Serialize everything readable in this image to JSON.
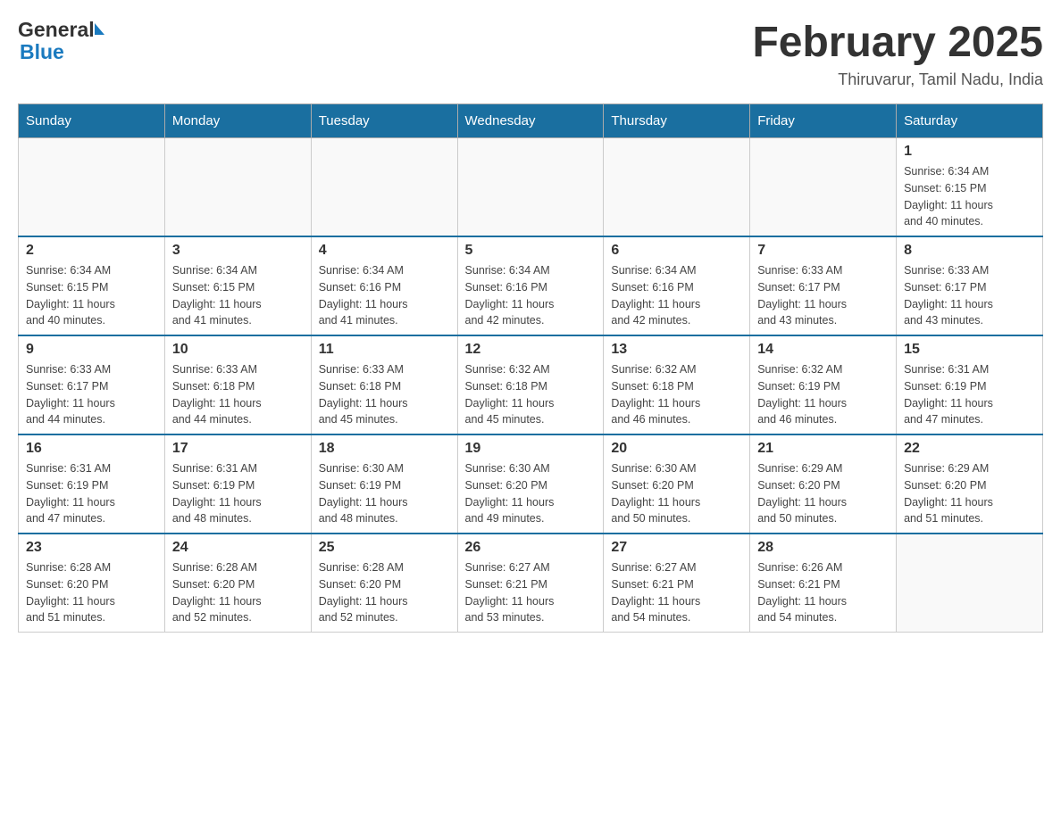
{
  "header": {
    "logo_general": "General",
    "logo_blue": "Blue",
    "title": "February 2025",
    "subtitle": "Thiruvarur, Tamil Nadu, India"
  },
  "days_of_week": [
    "Sunday",
    "Monday",
    "Tuesday",
    "Wednesday",
    "Thursday",
    "Friday",
    "Saturday"
  ],
  "weeks": [
    {
      "days": [
        {
          "num": "",
          "info": ""
        },
        {
          "num": "",
          "info": ""
        },
        {
          "num": "",
          "info": ""
        },
        {
          "num": "",
          "info": ""
        },
        {
          "num": "",
          "info": ""
        },
        {
          "num": "",
          "info": ""
        },
        {
          "num": "1",
          "info": "Sunrise: 6:34 AM\nSunset: 6:15 PM\nDaylight: 11 hours\nand 40 minutes."
        }
      ]
    },
    {
      "days": [
        {
          "num": "2",
          "info": "Sunrise: 6:34 AM\nSunset: 6:15 PM\nDaylight: 11 hours\nand 40 minutes."
        },
        {
          "num": "3",
          "info": "Sunrise: 6:34 AM\nSunset: 6:15 PM\nDaylight: 11 hours\nand 41 minutes."
        },
        {
          "num": "4",
          "info": "Sunrise: 6:34 AM\nSunset: 6:16 PM\nDaylight: 11 hours\nand 41 minutes."
        },
        {
          "num": "5",
          "info": "Sunrise: 6:34 AM\nSunset: 6:16 PM\nDaylight: 11 hours\nand 42 minutes."
        },
        {
          "num": "6",
          "info": "Sunrise: 6:34 AM\nSunset: 6:16 PM\nDaylight: 11 hours\nand 42 minutes."
        },
        {
          "num": "7",
          "info": "Sunrise: 6:33 AM\nSunset: 6:17 PM\nDaylight: 11 hours\nand 43 minutes."
        },
        {
          "num": "8",
          "info": "Sunrise: 6:33 AM\nSunset: 6:17 PM\nDaylight: 11 hours\nand 43 minutes."
        }
      ]
    },
    {
      "days": [
        {
          "num": "9",
          "info": "Sunrise: 6:33 AM\nSunset: 6:17 PM\nDaylight: 11 hours\nand 44 minutes."
        },
        {
          "num": "10",
          "info": "Sunrise: 6:33 AM\nSunset: 6:18 PM\nDaylight: 11 hours\nand 44 minutes."
        },
        {
          "num": "11",
          "info": "Sunrise: 6:33 AM\nSunset: 6:18 PM\nDaylight: 11 hours\nand 45 minutes."
        },
        {
          "num": "12",
          "info": "Sunrise: 6:32 AM\nSunset: 6:18 PM\nDaylight: 11 hours\nand 45 minutes."
        },
        {
          "num": "13",
          "info": "Sunrise: 6:32 AM\nSunset: 6:18 PM\nDaylight: 11 hours\nand 46 minutes."
        },
        {
          "num": "14",
          "info": "Sunrise: 6:32 AM\nSunset: 6:19 PM\nDaylight: 11 hours\nand 46 minutes."
        },
        {
          "num": "15",
          "info": "Sunrise: 6:31 AM\nSunset: 6:19 PM\nDaylight: 11 hours\nand 47 minutes."
        }
      ]
    },
    {
      "days": [
        {
          "num": "16",
          "info": "Sunrise: 6:31 AM\nSunset: 6:19 PM\nDaylight: 11 hours\nand 47 minutes."
        },
        {
          "num": "17",
          "info": "Sunrise: 6:31 AM\nSunset: 6:19 PM\nDaylight: 11 hours\nand 48 minutes."
        },
        {
          "num": "18",
          "info": "Sunrise: 6:30 AM\nSunset: 6:19 PM\nDaylight: 11 hours\nand 48 minutes."
        },
        {
          "num": "19",
          "info": "Sunrise: 6:30 AM\nSunset: 6:20 PM\nDaylight: 11 hours\nand 49 minutes."
        },
        {
          "num": "20",
          "info": "Sunrise: 6:30 AM\nSunset: 6:20 PM\nDaylight: 11 hours\nand 50 minutes."
        },
        {
          "num": "21",
          "info": "Sunrise: 6:29 AM\nSunset: 6:20 PM\nDaylight: 11 hours\nand 50 minutes."
        },
        {
          "num": "22",
          "info": "Sunrise: 6:29 AM\nSunset: 6:20 PM\nDaylight: 11 hours\nand 51 minutes."
        }
      ]
    },
    {
      "days": [
        {
          "num": "23",
          "info": "Sunrise: 6:28 AM\nSunset: 6:20 PM\nDaylight: 11 hours\nand 51 minutes."
        },
        {
          "num": "24",
          "info": "Sunrise: 6:28 AM\nSunset: 6:20 PM\nDaylight: 11 hours\nand 52 minutes."
        },
        {
          "num": "25",
          "info": "Sunrise: 6:28 AM\nSunset: 6:20 PM\nDaylight: 11 hours\nand 52 minutes."
        },
        {
          "num": "26",
          "info": "Sunrise: 6:27 AM\nSunset: 6:21 PM\nDaylight: 11 hours\nand 53 minutes."
        },
        {
          "num": "27",
          "info": "Sunrise: 6:27 AM\nSunset: 6:21 PM\nDaylight: 11 hours\nand 54 minutes."
        },
        {
          "num": "28",
          "info": "Sunrise: 6:26 AM\nSunset: 6:21 PM\nDaylight: 11 hours\nand 54 minutes."
        },
        {
          "num": "",
          "info": ""
        }
      ]
    }
  ]
}
